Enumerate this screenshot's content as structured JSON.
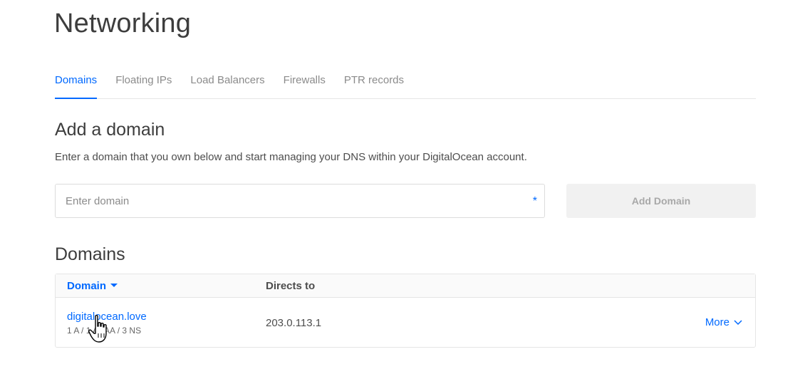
{
  "page": {
    "title": "Networking"
  },
  "tabs": [
    {
      "label": "Domains",
      "active": true
    },
    {
      "label": "Floating IPs",
      "active": false
    },
    {
      "label": "Load Balancers",
      "active": false
    },
    {
      "label": "Firewalls",
      "active": false
    },
    {
      "label": "PTR records",
      "active": false
    }
  ],
  "add_domain": {
    "title": "Add a domain",
    "description": "Enter a domain that you own below and start managing your DNS within your DigitalOcean account.",
    "input_placeholder": "Enter domain",
    "input_value": "",
    "required_mark": "*",
    "button_label": "Add Domain"
  },
  "domains": {
    "title": "Domains",
    "columns": {
      "domain": "Domain",
      "directs_to": "Directs to"
    },
    "rows": [
      {
        "name": "digitalocean.love",
        "records": "1 A / 1 AAAA / 3 NS",
        "directs_to": "203.0.113.1",
        "action": "More"
      }
    ]
  },
  "colors": {
    "accent": "#0069ff",
    "text": "#333333",
    "muted": "#8b8b8b",
    "button_disabled_bg": "#f1f1f1"
  },
  "icons": {
    "sort": "caret-down-icon",
    "more": "chevron-down-icon",
    "cursor": "hand-pointer-cursor"
  }
}
